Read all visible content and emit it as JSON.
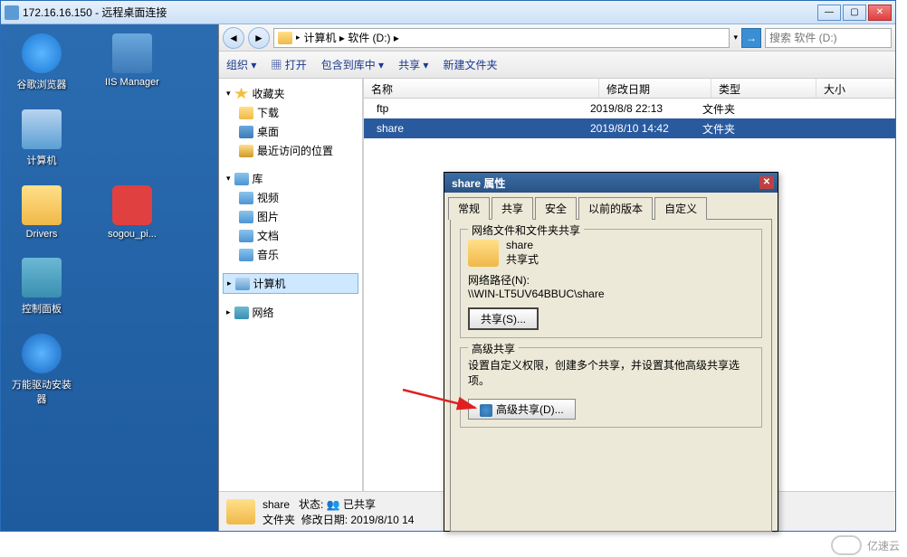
{
  "rdp": {
    "ip": "172.16.16.150",
    "title": "远程桌面连接"
  },
  "desktop": {
    "items": [
      "谷歌浏览器",
      "IIS Manager",
      "计算机",
      "Drivers",
      "sogou_pi...",
      "控制面板",
      "万能驱动安装器"
    ]
  },
  "nav": {
    "path": "计算机 ▸ 软件 (D:) ▸",
    "search_ph": "搜索 软件 (D:)"
  },
  "toolbar": {
    "org": "组织 ▾",
    "open": "打开",
    "lib": "包含到库中 ▾",
    "share": "共享 ▾",
    "newf": "新建文件夹"
  },
  "tree": {
    "fav": "收藏夹",
    "dl": "下载",
    "dsk": "桌面",
    "rec": "最近访问的位置",
    "lib": "库",
    "vid": "视频",
    "pic": "图片",
    "doc": "文档",
    "mus": "音乐",
    "pc": "计算机",
    "net": "网络"
  },
  "cols": {
    "n": "名称",
    "d": "修改日期",
    "t": "类型",
    "s": "大小"
  },
  "rows": [
    {
      "name": "ftp",
      "date": "2019/8/8 22:13",
      "type": "文件夹"
    },
    {
      "name": "share",
      "date": "2019/8/10 14:42",
      "type": "文件夹"
    }
  ],
  "status": {
    "name": "share",
    "state_l": "状态:",
    "state": "已共享",
    "type": "文件夹",
    "mod_l": "修改日期:",
    "mod": "2019/8/10 14"
  },
  "dlg": {
    "title": "share 属性",
    "tabs": [
      "常规",
      "共享",
      "安全",
      "以前的版本",
      "自定义"
    ],
    "g1": {
      "title": "网络文件和文件夹共享",
      "name": "share",
      "status": "共享式",
      "path_l": "网络路径(N):",
      "path": "\\\\WIN-LT5UV64BBUC\\share",
      "btn": "共享(S)..."
    },
    "g2": {
      "title": "高级共享",
      "desc": "设置自定义权限，创建多个共享，并设置其他高级共享选项。",
      "btn": "高级共享(D)..."
    }
  },
  "wm": "亿速云"
}
